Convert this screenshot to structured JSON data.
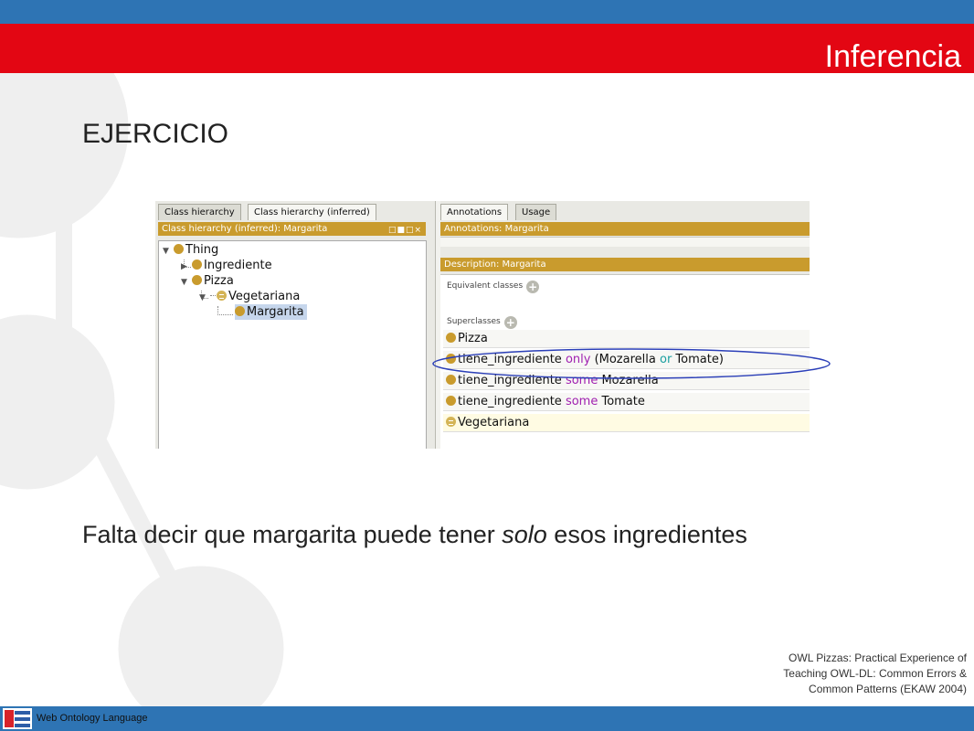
{
  "slide": {
    "title": "Inferencia",
    "heading": "EJERCICIO",
    "body_prefix": "Falta decir que margarita puede tener ",
    "body_emphasis": "solo",
    "body_suffix": " esos ingredientes",
    "credit_lines": [
      "OWL Pizzas: Practical Experience of",
      "Teaching OWL-DL: Common Errors &",
      "Common Patterns (EKAW 2004)"
    ],
    "footer_text": "Web Ontology Language"
  },
  "colors": {
    "top_blue": "#2e74b4",
    "top_red": "#e30613",
    "class_gold": "#c99b2d",
    "keyword_purple": "#a020b0",
    "keyword_teal": "#1a9fa0",
    "highlight_ellipse": "#2b3fb8"
  },
  "protege": {
    "left_tabs": [
      "Class hierarchy",
      "Class hierarchy (inferred)"
    ],
    "left_header": "Class hierarchy (inferred): Margarita",
    "tree": [
      {
        "label": "Thing",
        "icon": "class-icon"
      },
      {
        "label": "Ingrediente",
        "icon": "class-icon"
      },
      {
        "label": "Pizza",
        "icon": "class-icon"
      },
      {
        "label": "Vegetariana",
        "icon": "defined-class-icon"
      },
      {
        "label": "Margarita",
        "icon": "class-icon",
        "selected": true
      }
    ],
    "right_tabs": [
      "Annotations",
      "Usage"
    ],
    "annotations_header": "Annotations: Margarita",
    "description_header": "Description: Margarita",
    "equivalent_label": "Equivalent classes",
    "superclasses_label": "Superclasses",
    "superclasses": [
      {
        "parts": [
          {
            "t": "Pizza",
            "k": "plain"
          }
        ]
      },
      {
        "parts": [
          {
            "t": "tiene_ingrediente ",
            "k": "plain"
          },
          {
            "t": "only",
            "k": "purple"
          },
          {
            "t": " (Mozarella ",
            "k": "plain"
          },
          {
            "t": "or",
            "k": "teal"
          },
          {
            "t": " Tomate)",
            "k": "plain"
          }
        ]
      },
      {
        "parts": [
          {
            "t": "tiene_ingrediente ",
            "k": "plain"
          },
          {
            "t": "some",
            "k": "purple"
          },
          {
            "t": " Mozarella",
            "k": "plain"
          }
        ]
      },
      {
        "parts": [
          {
            "t": "tiene_ingrediente ",
            "k": "plain"
          },
          {
            "t": "some",
            "k": "purple"
          },
          {
            "t": " Tomate",
            "k": "plain"
          }
        ]
      },
      {
        "parts": [
          {
            "t": "Vegetariana",
            "k": "plain"
          }
        ]
      }
    ]
  }
}
